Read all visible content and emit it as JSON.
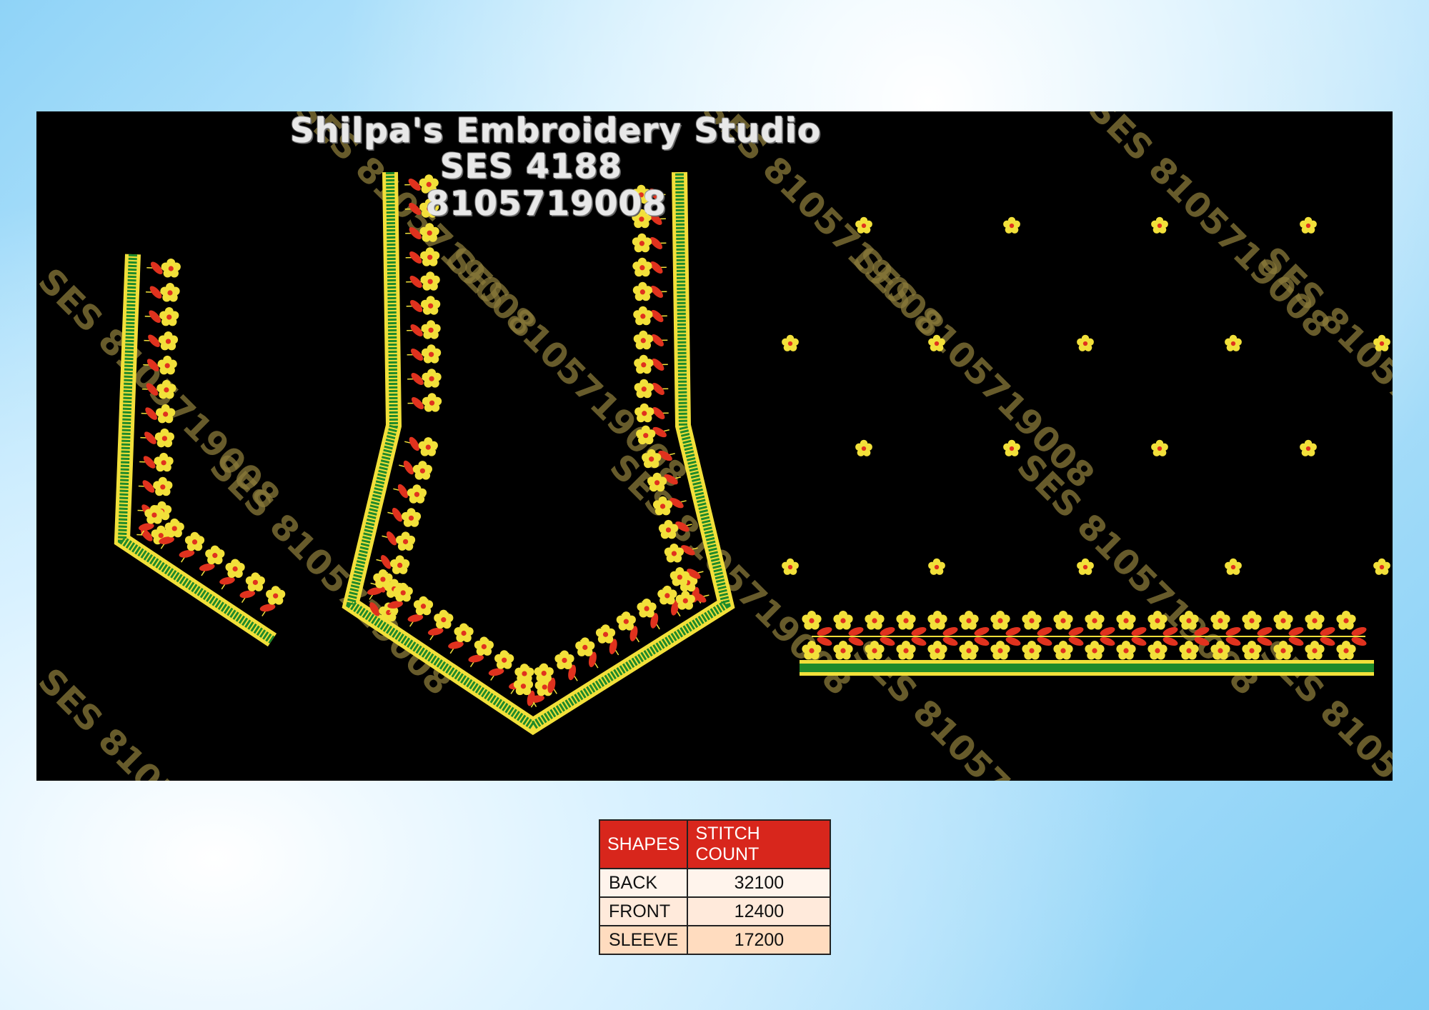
{
  "header": {
    "studio_name": "Shilpa's Embroidery Studio",
    "design_code": "SES 4188",
    "phone": "8105719008"
  },
  "watermark": "SES 8105719008",
  "stitch_table": {
    "headers": [
      "SHAPES",
      "STITCH COUNT"
    ],
    "rows": [
      {
        "shape": "BACK",
        "count": "32100"
      },
      {
        "shape": "FRONT",
        "count": "12400"
      },
      {
        "shape": "SLEEVE",
        "count": "17200"
      }
    ]
  },
  "colors": {
    "panel": "#000000",
    "thread_yellow": "#f2e03a",
    "thread_green": "#1f8a2a",
    "thread_red": "#e0321e",
    "table_header": "#d8261c",
    "watermark": "#8a7a3a"
  }
}
